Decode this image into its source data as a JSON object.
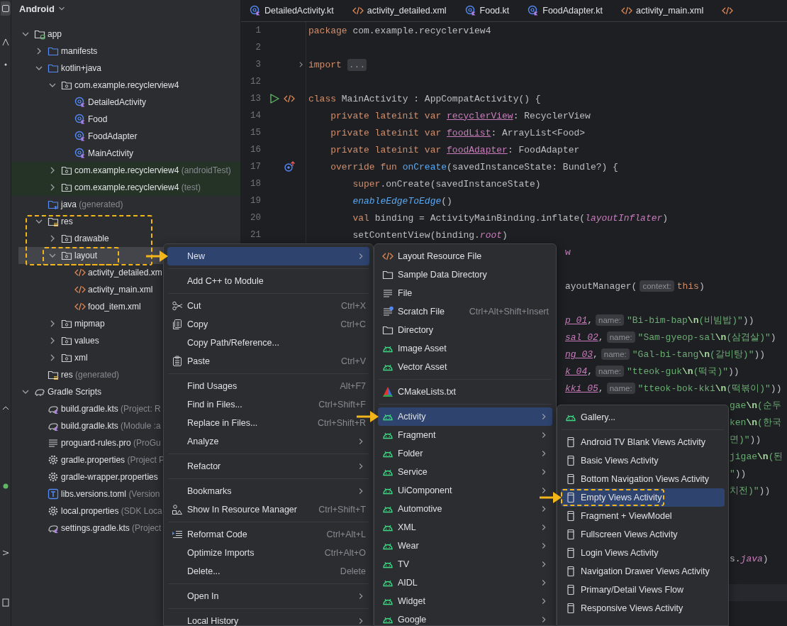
{
  "project": {
    "title": "Android",
    "tree": [
      {
        "label": "app",
        "kind": "module",
        "expanded": true,
        "selected": false,
        "children": [
          {
            "label": "manifests",
            "kind": "folder",
            "expanded": false,
            "selected": false
          },
          {
            "label": "kotlin+java",
            "kind": "folder",
            "expanded": true,
            "selected": false,
            "children": [
              {
                "label": "com.example.recyclerview4",
                "kind": "package",
                "expanded": true,
                "selected": false,
                "children": [
                  {
                    "label": "DetailedActivity",
                    "kind": "class",
                    "selected": false
                  },
                  {
                    "label": "Food",
                    "kind": "class",
                    "selected": false
                  },
                  {
                    "label": "FoodAdapter",
                    "kind": "class",
                    "selected": false
                  },
                  {
                    "label": "MainActivity",
                    "kind": "class",
                    "selected": false
                  }
                ]
              },
              {
                "label": "com.example.recyclerview4",
                "note": "(androidTest)",
                "kind": "package",
                "expanded": false,
                "selected": false,
                "tinted": true
              },
              {
                "label": "com.example.recyclerview4",
                "note": "(test)",
                "kind": "package",
                "expanded": false,
                "selected": false,
                "tinted": true
              }
            ]
          },
          {
            "label": "java",
            "note": "(generated)",
            "kind": "generated",
            "selected": false
          },
          {
            "label": "res",
            "kind": "resources",
            "expanded": true,
            "selected": false,
            "marked": true,
            "children": [
              {
                "label": "drawable",
                "kind": "package",
                "expanded": false,
                "selected": false
              },
              {
                "label": "layout",
                "kind": "package",
                "expanded": true,
                "selected": true,
                "marked": true,
                "children": [
                  {
                    "label": "activity_detailed.xm",
                    "kind": "layout",
                    "selected": false
                  },
                  {
                    "label": "activity_main.xml",
                    "kind": "layout",
                    "selected": false
                  },
                  {
                    "label": "food_item.xml",
                    "kind": "layout",
                    "selected": false
                  }
                ]
              },
              {
                "label": "mipmap",
                "kind": "package",
                "expanded": false,
                "selected": false
              },
              {
                "label": "values",
                "kind": "package",
                "expanded": false,
                "selected": false
              },
              {
                "label": "xml",
                "kind": "package",
                "expanded": false,
                "selected": false
              }
            ]
          },
          {
            "label": "res",
            "note": "(generated)",
            "kind": "resources",
            "selected": false
          }
        ]
      },
      {
        "label": "Gradle Scripts",
        "kind": "gradle",
        "expanded": true,
        "selected": false,
        "children": [
          {
            "label": "build.gradle.kts",
            "note": "(Project: R",
            "kind": "script",
            "selected": false
          },
          {
            "label": "build.gradle.kts",
            "note": "(Module :a",
            "kind": "script",
            "selected": false
          },
          {
            "label": "proguard-rules.pro",
            "note": "(ProGu",
            "kind": "text",
            "selected": false
          },
          {
            "label": "gradle.properties",
            "note": "(Project P",
            "kind": "properties",
            "selected": false
          },
          {
            "label": "gradle-wrapper.properties",
            "kind": "properties",
            "selected": false
          },
          {
            "label": "libs.versions.toml",
            "note": "(Version",
            "kind": "catalog",
            "selected": false
          },
          {
            "label": "local.properties",
            "note": "(SDK Loca",
            "kind": "properties",
            "selected": false
          },
          {
            "label": "settings.gradle.kts",
            "note": "(Project",
            "kind": "script",
            "selected": false
          }
        ]
      }
    ]
  },
  "editor": {
    "tabs": [
      {
        "label": "DetailedActivity.kt",
        "kind": "class"
      },
      {
        "label": "activity_detailed.xml",
        "kind": "layout"
      },
      {
        "label": "Food.kt",
        "kind": "class"
      },
      {
        "label": "FoodAdapter.kt",
        "kind": "class"
      },
      {
        "label": "activity_main.xml",
        "kind": "layout"
      },
      {
        "kind": "layout"
      }
    ],
    "lines": [
      {
        "kind": "line",
        "number": "1",
        "tokens": [
          {
            "kind": "keyword",
            "text": "package"
          },
          {
            "kind": "plain",
            "text": " com.example.recyclerview4"
          }
        ]
      },
      {
        "kind": "line",
        "number": "2"
      },
      {
        "kind": "line",
        "number": "3",
        "gutter": [
          {
            "kind": "fold"
          }
        ],
        "tokens": [
          {
            "kind": "keyword",
            "text": "import"
          },
          {
            "kind": "fold",
            "text": "..."
          }
        ]
      },
      {
        "kind": "line",
        "number": "12"
      },
      {
        "kind": "line",
        "number": "13",
        "gutter": [
          {
            "kind": "run"
          },
          {
            "kind": "layout"
          }
        ],
        "tokens": [
          {
            "kind": "keyword",
            "text": "class"
          },
          {
            "kind": "plain",
            "text": " MainActivity : AppCompatActivity() {"
          }
        ]
      },
      {
        "kind": "line",
        "number": "14",
        "tokens": [
          {
            "kind": "keyword",
            "text": "    private lateinit var "
          },
          {
            "kind": "property-link",
            "text": "recyclerView"
          },
          {
            "kind": "plain",
            "text": ": RecyclerView"
          }
        ]
      },
      {
        "kind": "line",
        "number": "15",
        "tokens": [
          {
            "kind": "keyword",
            "text": "    private lateinit var "
          },
          {
            "kind": "property-link",
            "text": "foodList"
          },
          {
            "kind": "plain",
            "text": ": ArrayList<Food>"
          }
        ]
      },
      {
        "kind": "line",
        "number": "16",
        "tokens": [
          {
            "kind": "keyword",
            "text": "    private lateinit var "
          },
          {
            "kind": "property-link",
            "text": "foodAdapter"
          },
          {
            "kind": "plain",
            "text": ": FoodAdapter"
          }
        ]
      },
      {
        "kind": "line",
        "number": "17",
        "gutter": [
          {
            "kind": "override"
          }
        ],
        "tokens": [
          {
            "kind": "keyword",
            "text": "    override fun "
          },
          {
            "kind": "function",
            "text": "onCreate"
          },
          {
            "kind": "plain",
            "text": "(savedInstanceState: Bundle?) {"
          }
        ]
      },
      {
        "kind": "line",
        "number": "18",
        "tokens": [
          {
            "kind": "keyword",
            "text": "        super"
          },
          {
            "kind": "plain",
            "text": ".onCreate(savedInstanceState)"
          }
        ]
      },
      {
        "kind": "line",
        "number": "19",
        "tokens": [
          {
            "kind": "function-italic",
            "text": "        enableEdgeToEdge"
          },
          {
            "kind": "plain",
            "text": "()"
          }
        ]
      },
      {
        "kind": "line",
        "number": "20",
        "tokens": [
          {
            "kind": "keyword",
            "text": "        val"
          },
          {
            "kind": "plain",
            "text": " binding = ActivityMainBinding.inflate("
          },
          {
            "kind": "property-italic",
            "text": "layoutInflater"
          },
          {
            "kind": "plain",
            "text": ")"
          }
        ]
      },
      {
        "kind": "line",
        "number": "21",
        "tokens": [
          {
            "kind": "plain",
            "text": "        setContentView(binding."
          },
          {
            "kind": "property-italic",
            "text": "root"
          },
          {
            "kind": "plain",
            "text": ")"
          }
        ]
      },
      {
        "kind": "fragment",
        "tokens": [
          {
            "kind": "property",
            "text": "w"
          }
        ]
      },
      {
        "kind": "fragment"
      },
      {
        "kind": "fragment",
        "tokens": [
          {
            "kind": "plain",
            "text": "ayoutManager("
          },
          {
            "kind": "hint",
            "text": "context:"
          },
          {
            "kind": "keyword",
            "text": "this"
          },
          {
            "kind": "plain",
            "text": ")"
          }
        ]
      },
      {
        "kind": "fragment"
      },
      {
        "kind": "fragment",
        "tokens": [
          {
            "kind": "static-link",
            "text": "p_01"
          },
          {
            "kind": "plain",
            "text": ","
          },
          {
            "kind": "hint",
            "text": "name:"
          },
          {
            "kind": "string",
            "text": "\"Bi-bim-bap"
          },
          {
            "kind": "escape",
            "text": "\\n"
          },
          {
            "kind": "string",
            "text": "(비빔밥)\""
          },
          {
            "kind": "plain",
            "text": "))"
          }
        ]
      },
      {
        "kind": "fragment",
        "tokens": [
          {
            "kind": "static-link",
            "text": "sal_02"
          },
          {
            "kind": "plain",
            "text": ","
          },
          {
            "kind": "hint",
            "text": "name:"
          },
          {
            "kind": "string",
            "text": "\"Sam-gyeop-sal"
          },
          {
            "kind": "escape",
            "text": "\\n"
          },
          {
            "kind": "string",
            "text": "(삼겹살)\""
          },
          {
            "kind": "plain",
            "text": ")"
          }
        ]
      },
      {
        "kind": "fragment",
        "tokens": [
          {
            "kind": "static-link",
            "text": "ng_03"
          },
          {
            "kind": "plain",
            "text": ","
          },
          {
            "kind": "hint",
            "text": "name:"
          },
          {
            "kind": "string",
            "text": "\"Gal-bi-tang"
          },
          {
            "kind": "escape",
            "text": "\\n"
          },
          {
            "kind": "string",
            "text": "(갈비탕)\""
          },
          {
            "kind": "plain",
            "text": "))"
          }
        ]
      },
      {
        "kind": "fragment",
        "tokens": [
          {
            "kind": "static-link",
            "text": "k_04"
          },
          {
            "kind": "plain",
            "text": ","
          },
          {
            "kind": "hint",
            "text": "name:"
          },
          {
            "kind": "string",
            "text": "\"tteok-guk"
          },
          {
            "kind": "escape",
            "text": "\\n"
          },
          {
            "kind": "string",
            "text": "(떡국)\""
          },
          {
            "kind": "plain",
            "text": "))"
          }
        ]
      },
      {
        "kind": "fragment",
        "tokens": [
          {
            "kind": "static-link",
            "text": "kki_05"
          },
          {
            "kind": "plain",
            "text": ","
          },
          {
            "kind": "hint",
            "text": "name:"
          },
          {
            "kind": "string",
            "text": "\"tteok-bok-kki"
          },
          {
            "kind": "escape",
            "text": "\\n"
          },
          {
            "kind": "string",
            "text": "(떡볶이)\""
          },
          {
            "kind": "plain",
            "text": "))"
          }
        ]
      },
      {
        "kind": "fragment",
        "tokens": [
          {
            "kind": "string",
            "text": "gae"
          },
          {
            "kind": "escape",
            "text": "\\n"
          },
          {
            "kind": "string",
            "text": "(순두"
          }
        ]
      },
      {
        "kind": "fragment",
        "tokens": [
          {
            "kind": "string",
            "text": "ken"
          },
          {
            "kind": "escape",
            "text": "\\n"
          },
          {
            "kind": "string",
            "text": "(한국"
          }
        ]
      },
      {
        "kind": "fragment",
        "tokens": [
          {
            "kind": "string",
            "text": "면)\""
          },
          {
            "kind": "plain",
            "text": "))"
          }
        ]
      },
      {
        "kind": "fragment",
        "tokens": [
          {
            "kind": "string",
            "text": "jigae"
          },
          {
            "kind": "escape",
            "text": "\\n"
          },
          {
            "kind": "string",
            "text": "(된"
          }
        ]
      },
      {
        "kind": "fragment",
        "tokens": [
          {
            "kind": "string",
            "text": "\""
          },
          {
            "kind": "plain",
            "text": "))"
          }
        ]
      },
      {
        "kind": "fragment",
        "tokens": [
          {
            "kind": "string",
            "text": "치전)\""
          },
          {
            "kind": "plain",
            "text": "))"
          }
        ]
      },
      {
        "kind": "fragment"
      },
      {
        "kind": "fragment"
      },
      {
        "kind": "fragment"
      },
      {
        "kind": "fragment",
        "tokens": [
          {
            "kind": "plain",
            "text": "s."
          },
          {
            "kind": "property-italic",
            "text": "java"
          },
          {
            "kind": "plain",
            "text": ")"
          }
        ]
      },
      {
        "kind": "fragment"
      },
      {
        "kind": "current"
      }
    ]
  },
  "menus": [
    {
      "items": [
        {
          "kind": "plain",
          "label": "New",
          "submenu": true,
          "selected": true,
          "pointed": true
        },
        {
          "kind": "separator"
        },
        {
          "kind": "plain",
          "label": "Add C++ to Module",
          "selected": false
        },
        {
          "kind": "separator"
        },
        {
          "kind": "cut",
          "label": "Cut",
          "shortcut": "Ctrl+X",
          "selected": false
        },
        {
          "kind": "copy",
          "label": "Copy",
          "shortcut": "Ctrl+C",
          "selected": false
        },
        {
          "kind": "plain",
          "label": "Copy Path/Reference...",
          "selected": false
        },
        {
          "kind": "paste",
          "label": "Paste",
          "shortcut": "Ctrl+V",
          "selected": false
        },
        {
          "kind": "separator"
        },
        {
          "kind": "plain",
          "label": "Find Usages",
          "shortcut": "Alt+F7",
          "selected": false
        },
        {
          "kind": "plain",
          "label": "Find in Files...",
          "shortcut": "Ctrl+Shift+F",
          "selected": false
        },
        {
          "kind": "plain",
          "label": "Replace in Files...",
          "shortcut": "Ctrl+Shift+R",
          "selected": false
        },
        {
          "kind": "plain",
          "label": "Analyze",
          "submenu": true,
          "selected": false
        },
        {
          "kind": "separator"
        },
        {
          "kind": "plain",
          "label": "Refactor",
          "submenu": true,
          "selected": false
        },
        {
          "kind": "separator"
        },
        {
          "kind": "plain",
          "label": "Bookmarks",
          "submenu": true,
          "selected": false
        },
        {
          "kind": "resources",
          "label": "Show In Resource Manager",
          "shortcut": "Ctrl+Shift+T",
          "selected": false
        },
        {
          "kind": "separator"
        },
        {
          "kind": "reformat",
          "label": "Reformat Code",
          "shortcut": "Ctrl+Alt+L",
          "selected": false
        },
        {
          "kind": "plain",
          "label": "Optimize Imports",
          "shortcut": "Ctrl+Alt+O",
          "selected": false
        },
        {
          "kind": "plain",
          "label": "Delete...",
          "shortcut": "Delete",
          "selected": false
        },
        {
          "kind": "separator"
        },
        {
          "kind": "plain",
          "label": "Open In",
          "submenu": true,
          "selected": false
        },
        {
          "kind": "separator"
        },
        {
          "kind": "plain",
          "label": "Local History",
          "submenu": true,
          "selected": false
        }
      ]
    },
    {
      "items": [
        {
          "kind": "layout",
          "label": "Layout Resource File",
          "selected": false
        },
        {
          "kind": "folder",
          "label": "Sample Data Directory",
          "selected": false
        },
        {
          "kind": "file",
          "label": "File",
          "selected": false
        },
        {
          "kind": "scratch",
          "label": "Scratch File",
          "shortcut": "Ctrl+Alt+Shift+Insert",
          "selected": false
        },
        {
          "kind": "folder",
          "label": "Directory",
          "selected": false
        },
        {
          "kind": "android",
          "label": "Image Asset",
          "selected": false
        },
        {
          "kind": "android",
          "label": "Vector Asset",
          "selected": false
        },
        {
          "kind": "separator"
        },
        {
          "kind": "cmake",
          "label": "CMakeLists.txt",
          "selected": false
        },
        {
          "kind": "separator"
        },
        {
          "kind": "android",
          "label": "Activity",
          "submenu": true,
          "selected": true,
          "pointed": true
        },
        {
          "kind": "android",
          "label": "Fragment",
          "submenu": true,
          "selected": false
        },
        {
          "kind": "android",
          "label": "Folder",
          "submenu": true,
          "selected": false
        },
        {
          "kind": "android",
          "label": "Service",
          "submenu": true,
          "selected": false
        },
        {
          "kind": "android",
          "label": "UiComponent",
          "submenu": true,
          "selected": false
        },
        {
          "kind": "android",
          "label": "Automotive",
          "submenu": true,
          "selected": false
        },
        {
          "kind": "android",
          "label": "XML",
          "submenu": true,
          "selected": false
        },
        {
          "kind": "android",
          "label": "Wear",
          "submenu": true,
          "selected": false
        },
        {
          "kind": "android",
          "label": "TV",
          "submenu": true,
          "selected": false
        },
        {
          "kind": "android",
          "label": "AIDL",
          "submenu": true,
          "selected": false
        },
        {
          "kind": "android",
          "label": "Widget",
          "submenu": true,
          "selected": false
        },
        {
          "kind": "android",
          "label": "Google",
          "submenu": true,
          "selected": false
        }
      ]
    },
    {
      "items": [
        {
          "kind": "android",
          "label": "Gallery...",
          "selected": false
        },
        {
          "kind": "separator"
        },
        {
          "kind": "screen",
          "label": "Android TV Blank Views Activity",
          "selected": false
        },
        {
          "kind": "screen",
          "label": "Basic Views Activity",
          "selected": false
        },
        {
          "kind": "screen",
          "label": "Bottom Navigation Views Activity",
          "selected": false
        },
        {
          "kind": "screen",
          "label": "Empty Views Activity",
          "selected": true,
          "pointed": true,
          "marked": true
        },
        {
          "kind": "screen",
          "label": "Fragment + ViewModel",
          "selected": false
        },
        {
          "kind": "screen",
          "label": "Fullscreen Views Activity",
          "selected": false
        },
        {
          "kind": "screen",
          "label": "Login Views Activity",
          "selected": false
        },
        {
          "kind": "screen",
          "label": "Navigation Drawer Views Activity",
          "selected": false
        },
        {
          "kind": "screen",
          "label": "Primary/Detail Views Flow",
          "selected": false
        },
        {
          "kind": "screen",
          "label": "Responsive Views Activity",
          "selected": false
        }
      ]
    }
  ]
}
